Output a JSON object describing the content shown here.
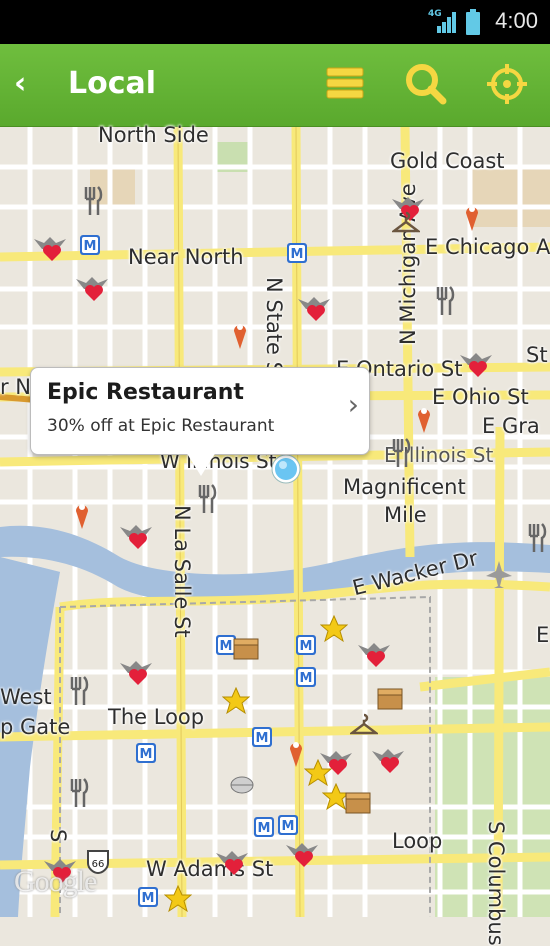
{
  "status_bar": {
    "network": "4G",
    "time": "4:00"
  },
  "header": {
    "back_glyph": "‹",
    "title": "Local",
    "menu_icon": "list-icon",
    "search_icon": "search-icon",
    "locate_icon": "crosshair-icon",
    "accent": "#f5d742",
    "bar_color": "#63b535"
  },
  "callout": {
    "title": "Epic Restaurant",
    "subtitle": "30% off at Epic Restaurant",
    "chevron": "›"
  },
  "map": {
    "neighborhoods": [
      "North Side",
      "Gold Coast",
      "Near North",
      "Magnificent",
      "Mile",
      "The Loop",
      "West",
      "p Gate",
      "r N",
      "Loop"
    ],
    "streets": [
      "E Chicago A",
      "N Michigan Ave",
      "N State St",
      "E Ontario St",
      "E Ohio St",
      "E Gra",
      "St",
      "W Illinois St",
      "E Illinois St",
      "N La Salle St",
      "E Wacker Dr",
      "W Adams St",
      "S Columbus",
      "S",
      "E"
    ],
    "attribution": "Google",
    "marker_types": [
      "restaurant-fork-icon",
      "heart-winged-icon",
      "pin-icon",
      "metro-icon",
      "star-icon",
      "package-icon",
      "hanger-icon",
      "airplane-icon",
      "mouse-icon",
      "highway-66-icon",
      "location-dot-icon"
    ],
    "river_color": "#a5bfdd",
    "highway_color": "#f8e97a"
  }
}
